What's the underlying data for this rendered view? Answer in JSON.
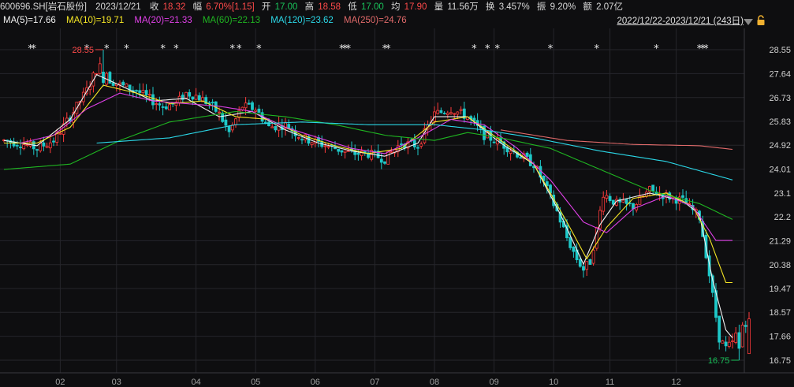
{
  "header": {
    "code": "600696.SH[岩石股份]",
    "date": "2023/12/21",
    "close_label": "收",
    "close": "18.32",
    "change_label": "幅",
    "change": "6.70%[1.15]",
    "open_label": "开",
    "open": "17.00",
    "high_label": "高",
    "high": "18.58",
    "low_label": "低",
    "low": "17.00",
    "avg_label": "均",
    "avg": "17.90",
    "volume_label": "量",
    "volume": "11.56万",
    "turnover_label": "换",
    "turnover": "3.457%",
    "amplitude_label": "振",
    "amplitude": "9.20%",
    "amount_label": "额",
    "amount": "2.07亿"
  },
  "range_text": "2022/12/22-2023/12/21 (243日)",
  "moving_averages": [
    {
      "label": "MA(5)=17.66",
      "color": "#f2f2f2"
    },
    {
      "label": "MA(10)=19.71",
      "color": "#f5e625"
    },
    {
      "label": "MA(20)=21.33",
      "color": "#e040e8"
    },
    {
      "label": "MA(60)=22.13",
      "color": "#1fb521"
    },
    {
      "label": "MA(120)=23.62",
      "color": "#2bd8e8"
    },
    {
      "label": "MA(250)=24.76",
      "color": "#e06a6a"
    }
  ],
  "chart_data": {
    "type": "candlestick",
    "y_ticks": [
      "28.55",
      "27.64",
      "26.73",
      "25.83",
      "24.92",
      "24.01",
      "23.1",
      "22.2",
      "21.29",
      "20.38",
      "19.47",
      "18.57",
      "17.66",
      "16.75"
    ],
    "ylim": [
      16.75,
      28.55
    ],
    "x_ticks": [
      "02",
      "03",
      "04",
      "05",
      "06",
      "07",
      "08",
      "09",
      "10",
      "11",
      "12"
    ],
    "n_days": 243,
    "x_tick_days": [
      17,
      34,
      58,
      76,
      94,
      112,
      130,
      148,
      166,
      183,
      203
    ],
    "max_label": "28.55",
    "max_day": 30,
    "min_label": "16.75",
    "min_day": 222,
    "star_days": [
      8,
      9,
      25,
      31,
      37,
      48,
      52,
      69,
      71,
      77,
      102,
      103,
      104,
      115,
      116,
      142,
      146,
      149,
      165,
      179,
      197,
      210,
      211,
      212
    ],
    "candle_anchors": [
      [
        0,
        25.1
      ],
      [
        5,
        25.0
      ],
      [
        10,
        24.8
      ],
      [
        15,
        25.1
      ],
      [
        20,
        26.0
      ],
      [
        25,
        27.0
      ],
      [
        28,
        27.8
      ],
      [
        30,
        28.0
      ],
      [
        32,
        27.4
      ],
      [
        35,
        27.2
      ],
      [
        40,
        27.0
      ],
      [
        45,
        26.6
      ],
      [
        48,
        26.4
      ],
      [
        52,
        26.5
      ],
      [
        55,
        26.9
      ],
      [
        58,
        26.8
      ],
      [
        62,
        26.5
      ],
      [
        65,
        26.1
      ],
      [
        68,
        25.4
      ],
      [
        72,
        26.4
      ],
      [
        76,
        26.3
      ],
      [
        80,
        25.6
      ],
      [
        85,
        25.7
      ],
      [
        90,
        25.2
      ],
      [
        95,
        25.0
      ],
      [
        100,
        24.8
      ],
      [
        105,
        24.6
      ],
      [
        110,
        24.6
      ],
      [
        115,
        24.4
      ],
      [
        120,
        25.0
      ],
      [
        125,
        24.9
      ],
      [
        130,
        26.1
      ],
      [
        135,
        26.3
      ],
      [
        140,
        26.0
      ],
      [
        145,
        25.3
      ],
      [
        150,
        25.0
      ],
      [
        155,
        24.6
      ],
      [
        160,
        24.2
      ],
      [
        163,
        23.5
      ],
      [
        167,
        22.4
      ],
      [
        170,
        21.4
      ],
      [
        173,
        20.6
      ],
      [
        175,
        20.2
      ],
      [
        177,
        20.5
      ],
      [
        179,
        21.7
      ],
      [
        181,
        23.1
      ],
      [
        185,
        22.7
      ],
      [
        190,
        22.6
      ],
      [
        195,
        23.2
      ],
      [
        200,
        23.0
      ],
      [
        205,
        22.8
      ],
      [
        210,
        22.2
      ],
      [
        212,
        20.8
      ],
      [
        216,
        17.6
      ],
      [
        218,
        17.2
      ],
      [
        220,
        17.4
      ],
      [
        222,
        18.0
      ],
      [
        225,
        18.3
      ]
    ],
    "ma_anchors": {
      "MA5": [
        [
          0,
          25.1
        ],
        [
          10,
          24.9
        ],
        [
          20,
          25.9
        ],
        [
          28,
          27.6
        ],
        [
          35,
          27.2
        ],
        [
          45,
          26.6
        ],
        [
          55,
          26.7
        ],
        [
          65,
          26.0
        ],
        [
          75,
          26.2
        ],
        [
          85,
          25.5
        ],
        [
          95,
          25.0
        ],
        [
          105,
          24.7
        ],
        [
          115,
          24.5
        ],
        [
          125,
          25.0
        ],
        [
          130,
          26.0
        ],
        [
          140,
          26.0
        ],
        [
          150,
          25.0
        ],
        [
          160,
          24.2
        ],
        [
          168,
          22.3
        ],
        [
          175,
          20.4
        ],
        [
          180,
          21.9
        ],
        [
          185,
          22.8
        ],
        [
          195,
          23.1
        ],
        [
          205,
          22.8
        ],
        [
          210,
          22.3
        ],
        [
          214,
          19.8
        ],
        [
          218,
          17.9
        ],
        [
          220,
          17.6
        ]
      ],
      "MA10": [
        [
          0,
          25.0
        ],
        [
          10,
          25.0
        ],
        [
          20,
          25.6
        ],
        [
          30,
          27.2
        ],
        [
          40,
          26.9
        ],
        [
          50,
          26.5
        ],
        [
          60,
          26.6
        ],
        [
          70,
          26.0
        ],
        [
          80,
          25.9
        ],
        [
          90,
          25.3
        ],
        [
          100,
          24.9
        ],
        [
          110,
          24.6
        ],
        [
          120,
          24.8
        ],
        [
          130,
          25.8
        ],
        [
          140,
          26.0
        ],
        [
          150,
          25.1
        ],
        [
          160,
          24.2
        ],
        [
          170,
          22.0
        ],
        [
          176,
          20.6
        ],
        [
          182,
          21.8
        ],
        [
          190,
          22.9
        ],
        [
          200,
          23.1
        ],
        [
          208,
          22.6
        ],
        [
          213,
          21.4
        ],
        [
          218,
          19.7
        ],
        [
          220,
          19.7
        ]
      ],
      "MA20": [
        [
          5,
          25.0
        ],
        [
          15,
          25.3
        ],
        [
          25,
          26.3
        ],
        [
          35,
          26.9
        ],
        [
          45,
          26.6
        ],
        [
          55,
          26.5
        ],
        [
          65,
          26.4
        ],
        [
          75,
          26.2
        ],
        [
          85,
          25.6
        ],
        [
          95,
          25.2
        ],
        [
          105,
          24.8
        ],
        [
          115,
          24.6
        ],
        [
          125,
          25.2
        ],
        [
          135,
          25.9
        ],
        [
          145,
          25.7
        ],
        [
          155,
          24.8
        ],
        [
          165,
          23.6
        ],
        [
          175,
          22.0
        ],
        [
          182,
          21.6
        ],
        [
          190,
          22.5
        ],
        [
          200,
          23.0
        ],
        [
          208,
          22.6
        ],
        [
          215,
          21.3
        ],
        [
          220,
          21.3
        ]
      ],
      "MA60": [
        [
          0,
          24.0
        ],
        [
          20,
          24.2
        ],
        [
          35,
          25.1
        ],
        [
          50,
          25.8
        ],
        [
          70,
          26.2
        ],
        [
          85,
          26.0
        ],
        [
          100,
          25.7
        ],
        [
          115,
          25.3
        ],
        [
          130,
          25.1
        ],
        [
          140,
          25.4
        ],
        [
          150,
          25.2
        ],
        [
          165,
          24.8
        ],
        [
          180,
          24.0
        ],
        [
          195,
          23.2
        ],
        [
          210,
          22.7
        ],
        [
          220,
          22.1
        ]
      ],
      "MA120": [
        [
          28,
          25.0
        ],
        [
          50,
          25.2
        ],
        [
          70,
          25.7
        ],
        [
          90,
          25.8
        ],
        [
          110,
          25.7
        ],
        [
          130,
          25.7
        ],
        [
          145,
          25.5
        ],
        [
          160,
          25.2
        ],
        [
          180,
          24.7
        ],
        [
          200,
          24.3
        ],
        [
          220,
          23.6
        ]
      ],
      "MA250": [
        [
          150,
          25.5
        ],
        [
          170,
          25.1
        ],
        [
          190,
          24.95
        ],
        [
          210,
          24.9
        ],
        [
          220,
          24.76
        ]
      ]
    }
  }
}
